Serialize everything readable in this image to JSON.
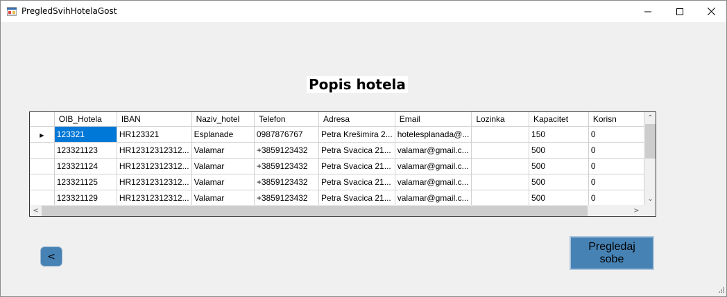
{
  "window": {
    "title": "PregledSvihHotelaGost",
    "controls": {
      "minimize": "─",
      "maximize": "☐",
      "close": "✕"
    }
  },
  "heading": "Popis hotela",
  "grid": {
    "columns": [
      "OIB_Hotela",
      "IBAN",
      "Naziv_hotel",
      "Telefon",
      "Adresa",
      "Email",
      "Lozinka",
      "Kapacitet",
      "Korisn"
    ],
    "current_row_marker": "▶",
    "rows": [
      [
        "123321",
        "HR123321",
        "Esplanade",
        "0987876767",
        "Petra Krešimira 2...",
        "hotelesplanada@...",
        "",
        "150",
        "0"
      ],
      [
        "123321123",
        "HR12312312312...",
        "Valamar",
        "+3859123432",
        "Petra Svacica 21...",
        "valamar@gmail.c...",
        "",
        "500",
        "0"
      ],
      [
        "123321124",
        "HR12312312312...",
        "Valamar",
        "+3859123432",
        "Petra Svacica 21...",
        "valamar@gmail.c...",
        "",
        "500",
        "0"
      ],
      [
        "123321125",
        "HR12312312312...",
        "Valamar",
        "+3859123432",
        "Petra Svacica 21...",
        "valamar@gmail.c...",
        "",
        "500",
        "0"
      ],
      [
        "123321129",
        "HR12312312312...",
        "Valamar",
        "+3859123432",
        "Petra Svacica 21...",
        "valamar@gmail.c...",
        "",
        "500",
        "0"
      ]
    ],
    "scroll_arrows": {
      "up": "⌃",
      "down": "⌄",
      "left": "<",
      "right": ">"
    }
  },
  "buttons": {
    "back_label": "<",
    "view_rooms_line1": "Pregledaj",
    "view_rooms_line2": "sobe"
  },
  "colors": {
    "button_fill": "#4682b4",
    "selection": "#0078d7",
    "window_bg": "#f0f0f0"
  }
}
